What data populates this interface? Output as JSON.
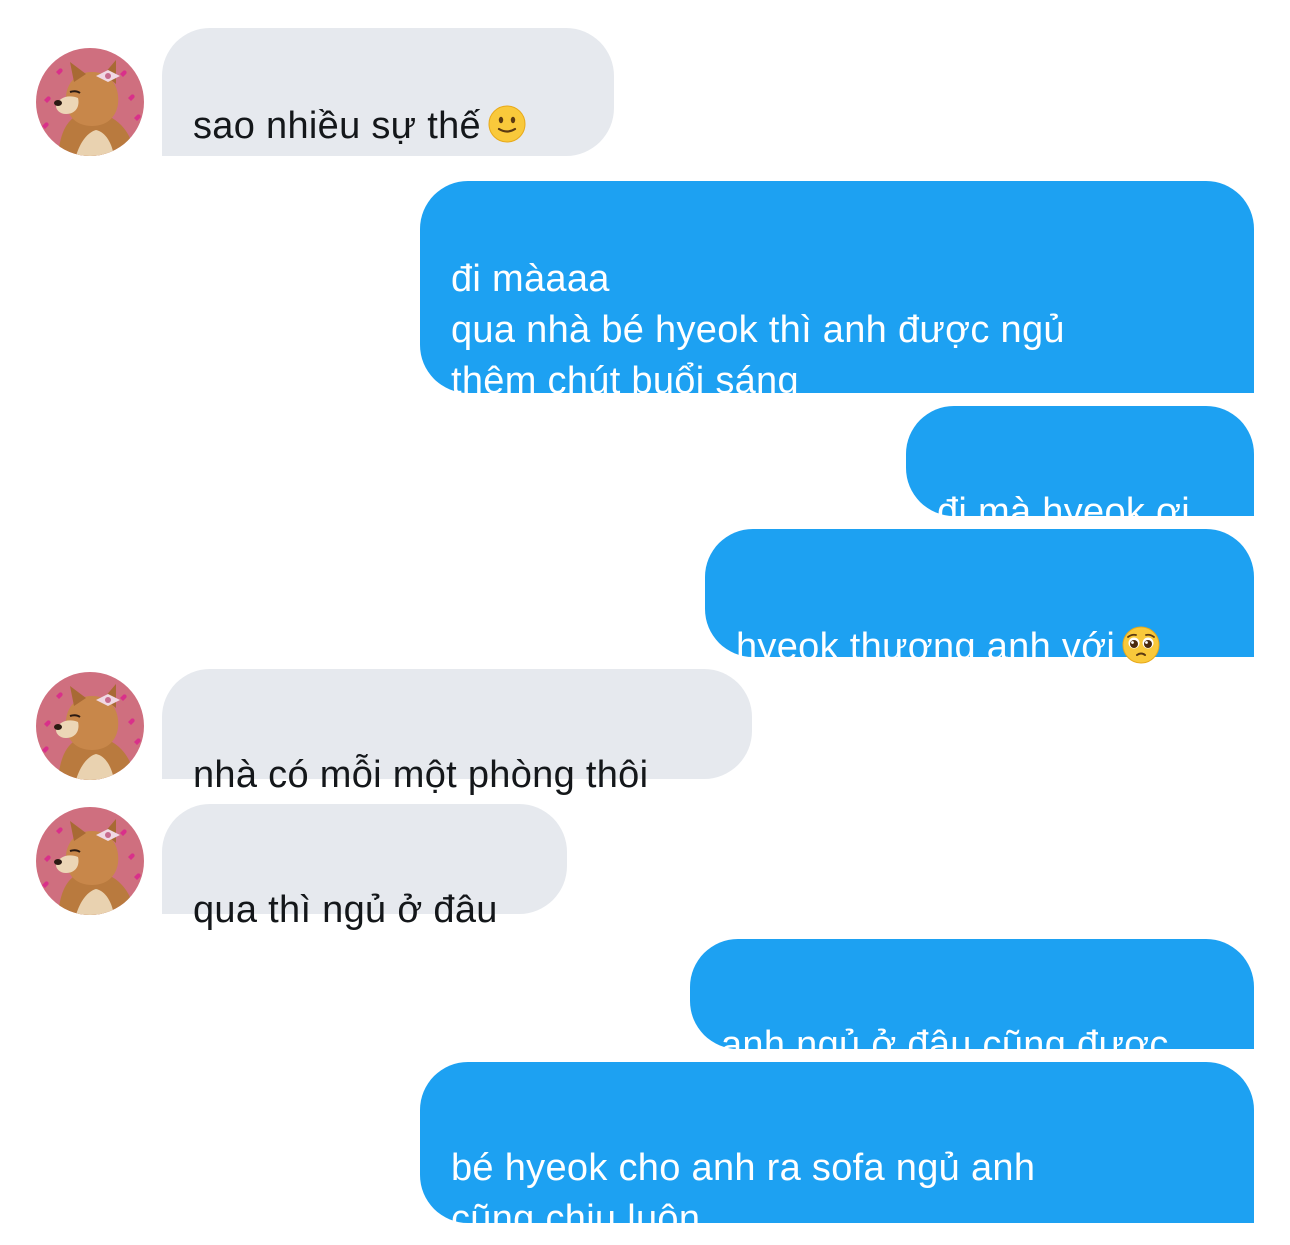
{
  "conversation": {
    "messages": [
      {
        "from": "other",
        "text": "sao nhiều sự thế",
        "emoji": "slightly-smiling-face-icon"
      },
      {
        "from": "me",
        "text": "đi màaaa\nqua nhà bé hyeok thì anh được ngủ\nthêm chút buổi sáng"
      },
      {
        "from": "me",
        "text": "đi mà hyeok ơi"
      },
      {
        "from": "me",
        "text": "hyeok thương anh với",
        "emoji": "pleading-face-icon"
      },
      {
        "from": "other",
        "text": "nhà có mỗi một phòng thôi"
      },
      {
        "from": "other",
        "text": "qua thì ngủ ở đâu"
      },
      {
        "from": "me",
        "text": "anh ngủ ở đâu cũng được"
      },
      {
        "from": "me",
        "text": "bé hyeok cho anh ra sofa ngủ anh\ncũng chịu luôn"
      }
    ]
  },
  "colors": {
    "sent_bubble": "#1da1f2",
    "received_bubble": "#e6e9ee",
    "received_text": "#14171a",
    "sent_text": "#ffffff"
  }
}
